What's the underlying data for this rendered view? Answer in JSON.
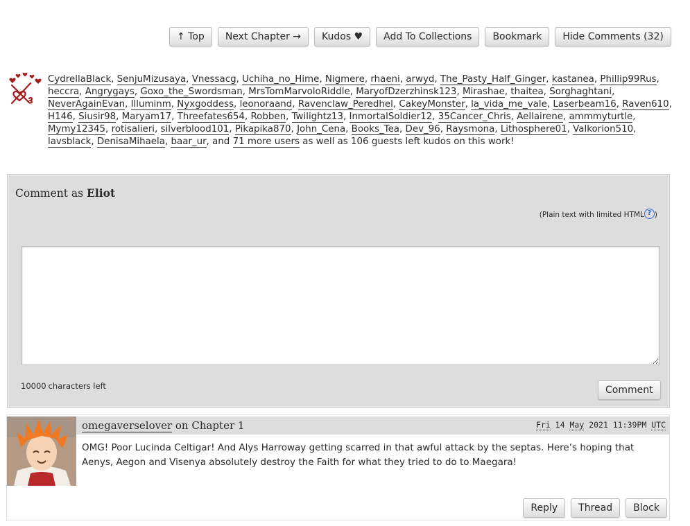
{
  "actions": {
    "top": "↑ Top",
    "next_chapter": "Next Chapter →",
    "kudos": "Kudos ♥",
    "add_to_collections": "Add To Collections",
    "bookmark": "Bookmark",
    "hide_comments": "Hide Comments (32)"
  },
  "kudos": {
    "users": [
      "CydrellaBlack",
      "SenjuMizusaya",
      "Vnessacg",
      "Uchiha_no_Hime",
      "Nigmere",
      "rhaeni",
      "arwyd",
      "The_Pasty_Half_Ginger",
      "kastanea",
      "Phillip99Rus",
      "heccra",
      "Angrygays",
      "Goxo_the_Swordsman",
      "MrsTomMarvoloRiddle",
      "MaryofDzerzhinsk123",
      "Mirashae",
      "thaitea",
      "Sorghaghtani",
      "NeverAgainEvan",
      "Illuminm",
      "Nyxgoddess",
      "leonoraand",
      "Ravenclaw_Peredhel",
      "CakeyMonster",
      "la_vida_me_vale",
      "Laserbeam16",
      "Raven610",
      "H146",
      "Siusir98",
      "Maryam17",
      "Threefates654",
      "Robben",
      "Twilightz13",
      "InmortalSoldier12",
      "35Cancer_Chris",
      "Aellairene",
      "ammmyturtle",
      "Mymy12345",
      "rotisalieri",
      "silverblood101",
      "Pikapika870",
      "John_Cena",
      "Books_Tea",
      "Dev_96",
      "Raysmona",
      "Lithosphere01",
      "Valkorion510",
      "lavsblack",
      "DenisaMihaela",
      "baar_ur"
    ],
    "and_text": ", and ",
    "more_users": "71 more users",
    "suffix": " as well as 106 guests left kudos on this work!"
  },
  "comment_form": {
    "comment_as_prefix": "Comment as ",
    "user": "Eliot",
    "plain_text_note": "(Plain text with limited HTML",
    "help_glyph": "?",
    "plain_text_close": ")",
    "chars_left_count": "10000",
    "chars_left_label": "characters left",
    "submit": "Comment"
  },
  "comment": {
    "author": "omegaverselover",
    "on_text": " on Chapter 1",
    "date_day": "Fri",
    "date_num": "14",
    "date_month": "May",
    "date_year_time": "2021 11:39PM",
    "date_tz": "UTC",
    "body": "OMG! Poor Lucinda Celtigar! And Alys Harroway getting scarred in that awful attack by the septas. Here’s hoping that Aenys, Aegon and Visenya absolutely destroy the Faith for what they tried to do to Maegara!",
    "reply": "Reply",
    "thread": "Thread",
    "block": "Block"
  },
  "colors": {
    "panel": "#dddddd",
    "text": "#2a2a2a",
    "kudos_icon": "#a51c1c",
    "help_icon": "#2a6ad6"
  },
  "icons": {
    "kudos": "kudos-hearts-icon",
    "help": "help-icon",
    "avatar": "avatar-image"
  }
}
